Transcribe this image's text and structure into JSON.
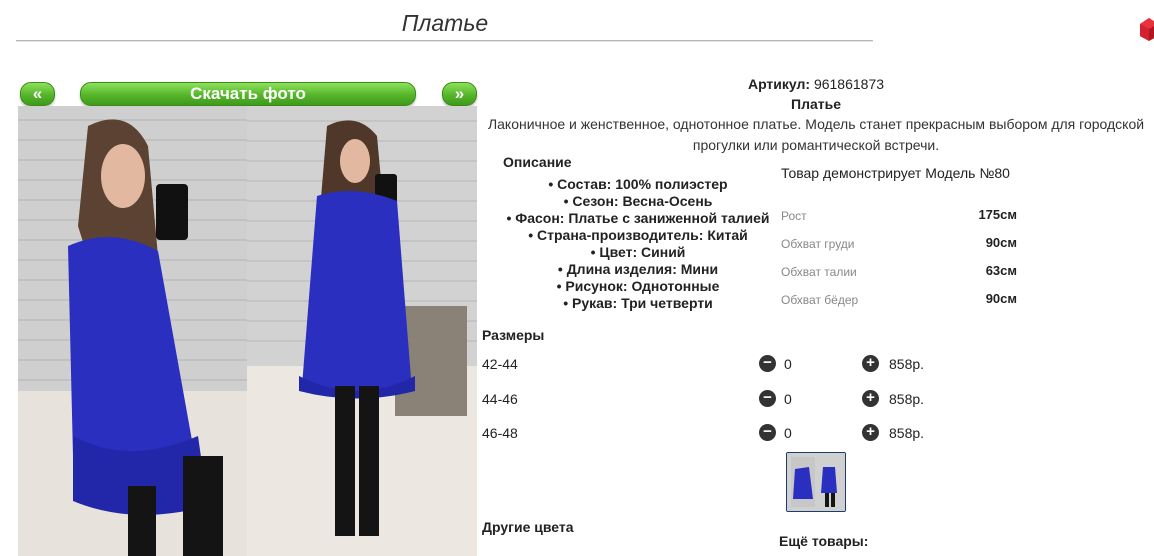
{
  "header": {
    "title": "Платье"
  },
  "gallery": {
    "prev_label": "«",
    "download_label": "Скачать фото",
    "next_label": "»"
  },
  "product": {
    "article_label": "Артикул:",
    "article_value": "961861873",
    "name": "Платье",
    "description": "Лаконичное и женственное, однотонное платье. Модель станет прекрасным выбором для городской прогулки или романтической встречи.",
    "description_heading": "Описание",
    "properties": [
      "• Состав: 100% полиэстер",
      "• Сезон: Весна-Осень",
      "• Фасон: Платье с заниженной талией",
      "• Страна-производитель: Китай",
      "• Цвет: Синий",
      "• Длина изделия: Мини",
      "• Рисунок: Однотонные",
      "• Рукав: Три четверти"
    ]
  },
  "model": {
    "note": "Товар демонстрирует Модель №80",
    "measurements": [
      {
        "label": "Рост",
        "value": "175см"
      },
      {
        "label": "Обхват груди",
        "value": "90см"
      },
      {
        "label": "Обхват талии",
        "value": "63см"
      },
      {
        "label": "Обхват бёдер",
        "value": "90см"
      }
    ]
  },
  "sizes": {
    "heading": "Размеры",
    "rows": [
      {
        "size": "42-44",
        "qty": "0",
        "price": "858р."
      },
      {
        "size": "44-46",
        "qty": "0",
        "price": "858р."
      },
      {
        "size": "46-48",
        "qty": "0",
        "price": "858р."
      }
    ],
    "minus_icon": "minus-circle-icon",
    "plus_icon": "plus-circle-icon"
  },
  "footer": {
    "other_colors": "Другие цвета",
    "more_items": "Ещё товары:"
  },
  "colors": {
    "accent_green": "#55b52a",
    "dress_blue": "#2a2fc0",
    "corner_red": "#d3212d"
  }
}
